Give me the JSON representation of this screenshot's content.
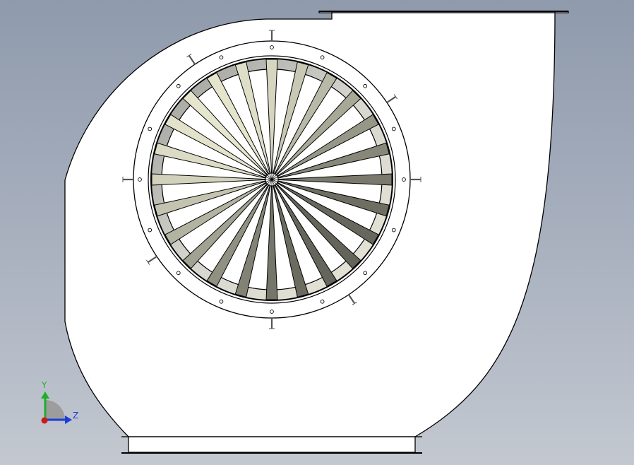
{
  "view": {
    "background_top": "#8f9aac",
    "background_bottom": "#c3c8d0"
  },
  "model": {
    "housing_fill": "#ffffff",
    "outline_color": "#000000",
    "flange_bolt_holes": 16,
    "impeller_blades": 24
  },
  "triad": {
    "y_label": "Y",
    "z_label": "Z",
    "y_color": "#1fae2a",
    "z_color": "#1c3dd6",
    "x_color": "#d01818"
  }
}
